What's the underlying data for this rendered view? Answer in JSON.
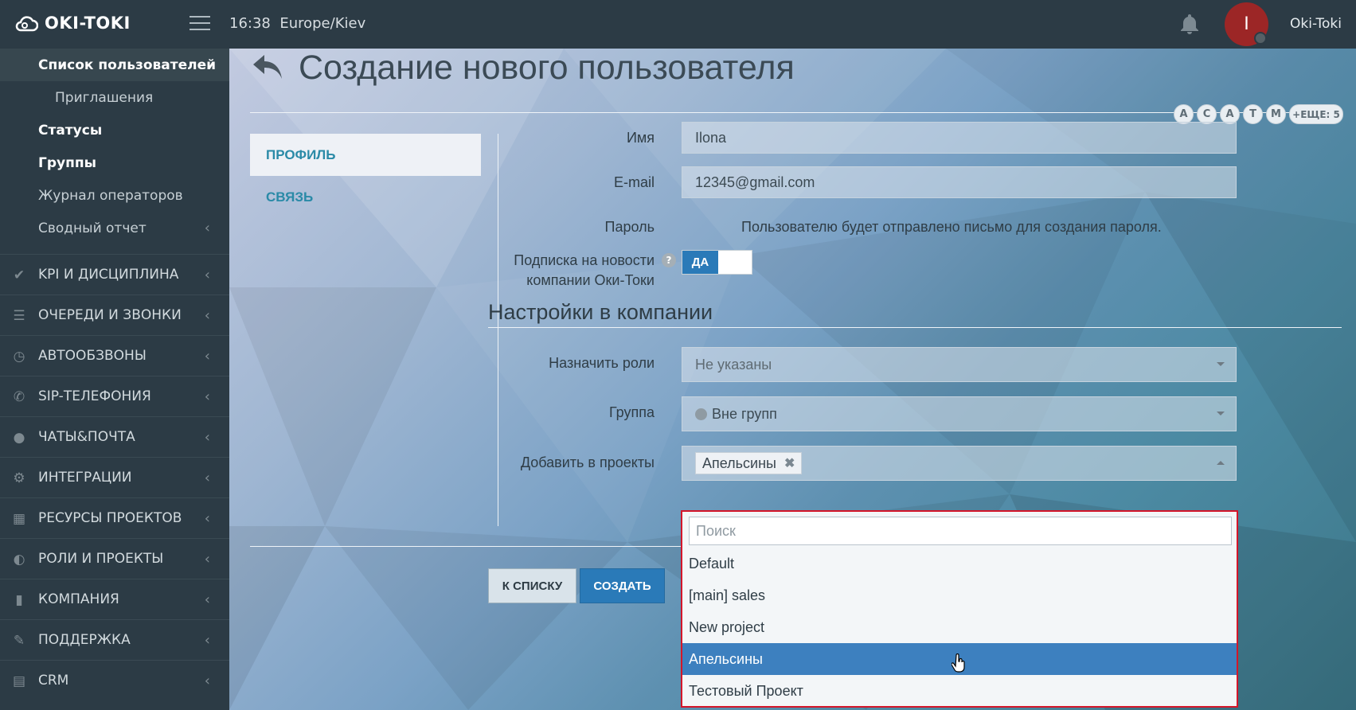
{
  "app": {
    "logo": "OKI-TOKI",
    "time": "16:38",
    "timezone": "Europe/Kiev",
    "user_initial": "I",
    "username": "Oki-Toki"
  },
  "sidebar": {
    "sub_items": [
      {
        "label": "Список пользователей"
      },
      {
        "label": "Приглашения"
      },
      {
        "label": "Статусы"
      },
      {
        "label": "Группы"
      },
      {
        "label": "Журнал операторов"
      },
      {
        "label": "Сводный отчет"
      }
    ],
    "sections": [
      {
        "label": "KPI И ДИСЦИПЛИНА",
        "icon": "check-icon"
      },
      {
        "label": "ОЧЕРЕДИ И ЗВОНКИ",
        "icon": "list-icon"
      },
      {
        "label": "АВТООБЗВОНЫ",
        "icon": "clock-icon"
      },
      {
        "label": "SIP-ТЕЛЕФОНИЯ",
        "icon": "phone-icon"
      },
      {
        "label": "ЧАТЫ&ПОЧТА",
        "icon": "chat-icon"
      },
      {
        "label": "ИНТЕГРАЦИИ",
        "icon": "gears-icon"
      },
      {
        "label": "РЕСУРСЫ ПРОЕКТОВ",
        "icon": "grid-icon"
      },
      {
        "label": "РОЛИ И ПРОЕКТЫ",
        "icon": "toggle-icon"
      },
      {
        "label": "КОМПАНИЯ",
        "icon": "bar-chart-icon"
      },
      {
        "label": "ПОДДЕРЖКА",
        "icon": "wrench-icon"
      },
      {
        "label": "CRM",
        "icon": "table-icon"
      }
    ]
  },
  "page": {
    "title": "Создание нового пользователя",
    "chips": [
      "A",
      "C",
      "A",
      "T",
      "M"
    ],
    "chips_more": "+ЕЩЕ: 5",
    "tabs": {
      "profile": "ПРОФИЛЬ",
      "contact": "СВЯЗЬ"
    }
  },
  "form": {
    "name_label": "Имя",
    "name_value": "Ilona",
    "email_label": "E-mail",
    "email_value": "12345@gmail.com",
    "password_label": "Пароль",
    "password_text": "Пользователю будет отправлено письмо для создания пароля.",
    "subscribe_label_1": "Подписка на новости",
    "subscribe_label_2": "компании Оки-Токи",
    "subscribe_toggle": "ДА",
    "company_section": "Настройки в компании",
    "roles_label": "Назначить роли",
    "roles_value": "Не указаны",
    "group_label": "Группа",
    "group_value": "Вне групп",
    "projects_label": "Добавить в проекты",
    "projects_tag": "Апельсины",
    "btn_list": "К СПИСКУ",
    "btn_create": "СОЗДАТЬ"
  },
  "dropdown": {
    "search_placeholder": "Поиск",
    "options": [
      {
        "label": "Default"
      },
      {
        "label": "[main] sales"
      },
      {
        "label": "New project"
      },
      {
        "label": "Апельсины"
      },
      {
        "label": "Тестовый Проект"
      }
    ],
    "highlighted": "Апельсины"
  },
  "colors": {
    "accent": "#2a7ab8",
    "sidebar": "#2c3b45",
    "highlight": "#3d80bf",
    "dropdown_border": "#d4162a"
  }
}
